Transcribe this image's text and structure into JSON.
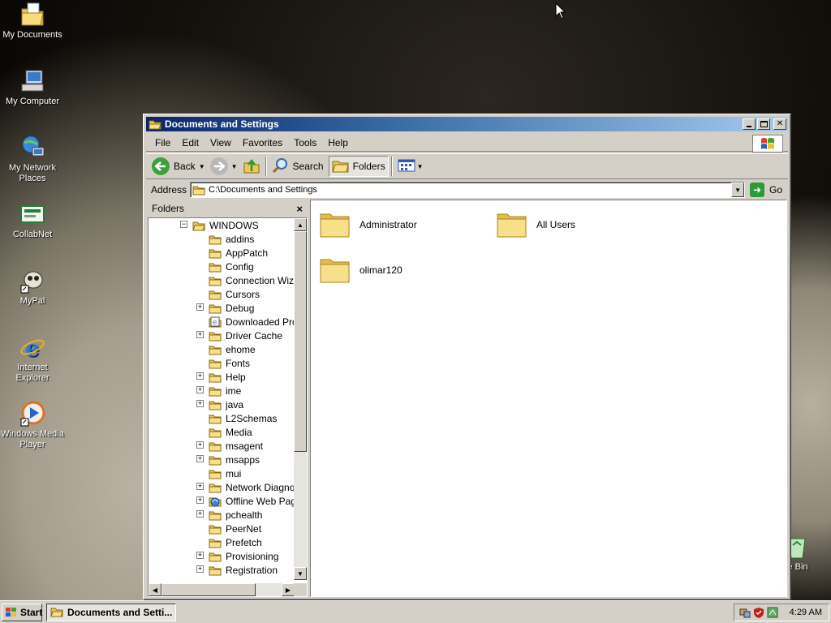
{
  "desktop": {
    "icons": [
      {
        "label": "My Documents",
        "icon": "my-documents-icon"
      },
      {
        "label": "My Computer",
        "icon": "my-computer-icon"
      },
      {
        "label": "My Network Places",
        "icon": "network-places-icon"
      },
      {
        "label": "CollabNet",
        "icon": "collabnet-icon"
      },
      {
        "label": "MyPal",
        "icon": "mypal-icon"
      },
      {
        "label": "Internet Explorer",
        "icon": "internet-explorer-icon"
      },
      {
        "label": "Windows Media Player",
        "icon": "media-player-icon"
      },
      {
        "label": "le Bin",
        "icon": "recycle-bin-icon"
      }
    ]
  },
  "window": {
    "title": "Documents and Settings",
    "menu": [
      "File",
      "Edit",
      "View",
      "Favorites",
      "Tools",
      "Help"
    ],
    "toolbar": {
      "back": "Back",
      "search": "Search",
      "folders": "Folders"
    },
    "address": {
      "label": "Address",
      "value": "C:\\Documents and Settings",
      "go": "Go"
    }
  },
  "folders_pane": {
    "title": "Folders",
    "close": "×",
    "root": "WINDOWS",
    "items": [
      {
        "label": "addins",
        "expandable": false,
        "icon": "folder-icon"
      },
      {
        "label": "AppPatch",
        "expandable": false,
        "icon": "folder-icon"
      },
      {
        "label": "Config",
        "expandable": false,
        "icon": "folder-icon"
      },
      {
        "label": "Connection Wizard",
        "expandable": false,
        "icon": "folder-icon"
      },
      {
        "label": "Cursors",
        "expandable": false,
        "icon": "folder-icon"
      },
      {
        "label": "Debug",
        "expandable": true,
        "icon": "folder-icon"
      },
      {
        "label": "Downloaded Program Files",
        "expandable": false,
        "icon": "downloaded-folder-icon"
      },
      {
        "label": "Driver Cache",
        "expandable": true,
        "icon": "folder-icon"
      },
      {
        "label": "ehome",
        "expandable": false,
        "icon": "folder-icon"
      },
      {
        "label": "Fonts",
        "expandable": false,
        "icon": "folder-icon"
      },
      {
        "label": "Help",
        "expandable": true,
        "icon": "folder-icon"
      },
      {
        "label": "ime",
        "expandable": true,
        "icon": "folder-icon"
      },
      {
        "label": "java",
        "expandable": true,
        "icon": "folder-icon"
      },
      {
        "label": "L2Schemas",
        "expandable": false,
        "icon": "folder-icon"
      },
      {
        "label": "Media",
        "expandable": false,
        "icon": "folder-icon"
      },
      {
        "label": "msagent",
        "expandable": true,
        "icon": "folder-icon"
      },
      {
        "label": "msapps",
        "expandable": true,
        "icon": "folder-icon"
      },
      {
        "label": "mui",
        "expandable": false,
        "icon": "folder-icon"
      },
      {
        "label": "Network Diagnostic",
        "expandable": true,
        "icon": "folder-icon"
      },
      {
        "label": "Offline Web Pages",
        "expandable": true,
        "icon": "offline-pages-icon"
      },
      {
        "label": "pchealth",
        "expandable": true,
        "icon": "folder-icon"
      },
      {
        "label": "PeerNet",
        "expandable": false,
        "icon": "folder-icon"
      },
      {
        "label": "Prefetch",
        "expandable": false,
        "icon": "folder-icon"
      },
      {
        "label": "Provisioning",
        "expandable": true,
        "icon": "folder-icon"
      },
      {
        "label": "Registration",
        "expandable": true,
        "icon": "folder-icon"
      }
    ]
  },
  "content": {
    "items": [
      "Administrator",
      "All Users",
      "olimar120"
    ]
  },
  "taskbar": {
    "start": "Start",
    "task": "Documents and Setti...",
    "clock": "4:29 AM"
  }
}
